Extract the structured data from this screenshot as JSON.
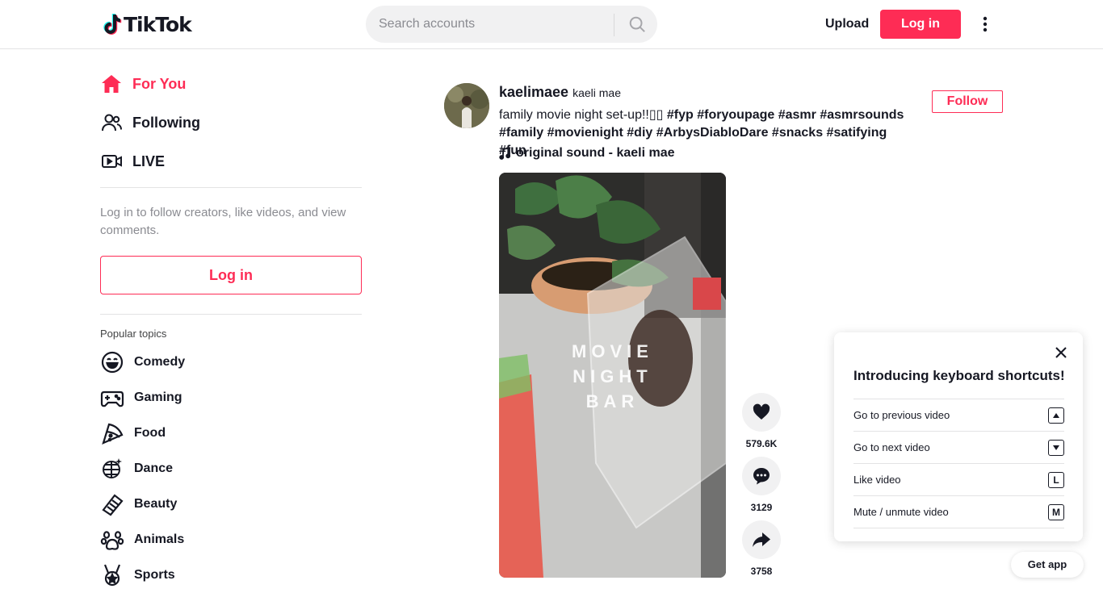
{
  "header": {
    "logo_text": "TikTok",
    "search_placeholder": "Search accounts",
    "upload_label": "Upload",
    "login_label": "Log in"
  },
  "sidebar": {
    "nav": [
      {
        "label": "For You",
        "icon": "home-icon",
        "active": true
      },
      {
        "label": "Following",
        "icon": "people-icon",
        "active": false
      },
      {
        "label": "LIVE",
        "icon": "live-icon",
        "active": false
      }
    ],
    "login_hint": "Log in to follow creators, like videos, and view comments.",
    "login_label": "Log in",
    "topics_title": "Popular topics",
    "topics": [
      {
        "label": "Comedy",
        "icon": "comedy-icon"
      },
      {
        "label": "Gaming",
        "icon": "gaming-icon"
      },
      {
        "label": "Food",
        "icon": "food-icon"
      },
      {
        "label": "Dance",
        "icon": "dance-icon"
      },
      {
        "label": "Beauty",
        "icon": "beauty-icon"
      },
      {
        "label": "Animals",
        "icon": "animals-icon"
      },
      {
        "label": "Sports",
        "icon": "sports-icon"
      }
    ]
  },
  "post": {
    "author_id": "kaelimaee",
    "author_name": "kaeli mae",
    "caption_text": "family movie night set-up!!▯▯ ",
    "hashtags": [
      "#fyp",
      "#foryoupage",
      "#asmr",
      "#asmrsounds",
      "#family",
      "#movienight",
      "#diy",
      "#ArbysDiabloDare",
      "#snacks",
      "#satifying",
      "#fun"
    ],
    "sound": "original sound - kaeli mae",
    "follow_label": "Follow",
    "video_overlay": "MOVIE NIGHT BAR",
    "likes": "579.6K",
    "comments": "3129",
    "shares": "3758"
  },
  "shortcuts": {
    "title": "Introducing keyboard shortcuts!",
    "items": [
      {
        "label": "Go to previous video",
        "key": "up-arrow"
      },
      {
        "label": "Go to next video",
        "key": "down-arrow"
      },
      {
        "label": "Like video",
        "key": "L"
      },
      {
        "label": "Mute / unmute video",
        "key": "M"
      }
    ]
  },
  "get_app_label": "Get app",
  "colors": {
    "accent": "#fe2c55",
    "text": "#161823",
    "muted": "#8a8b91"
  }
}
